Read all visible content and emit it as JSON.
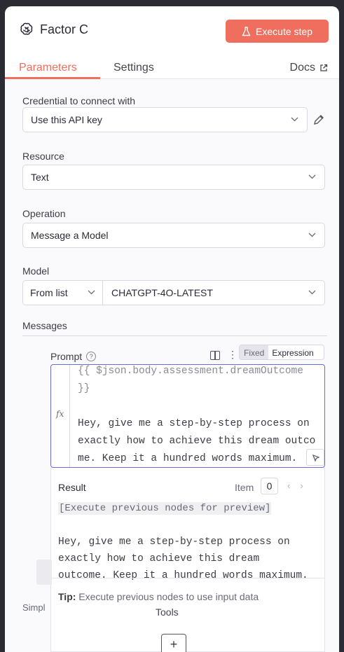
{
  "header": {
    "title": "Factor C",
    "execute_label": "Execute step"
  },
  "tabs": {
    "parameters": "Parameters",
    "settings": "Settings",
    "docs": "Docs"
  },
  "credential": {
    "label": "Credential to connect with",
    "value": "Use this API key"
  },
  "resource": {
    "label": "Resource",
    "value": "Text"
  },
  "operation": {
    "label": "Operation",
    "value": "Message a Model"
  },
  "model": {
    "label": "Model",
    "mode": "From list",
    "value": "CHATGPT-4O-LATEST"
  },
  "messages": {
    "label": "Messages",
    "prompt_label": "Prompt",
    "toggle_fixed": "Fixed",
    "toggle_expression": "Expression",
    "editor_line1": "{{ $json.body.assessment.dreamOutcome",
    "editor_line2": "}}",
    "editor_line3": "",
    "editor_line4": "Hey, give me a step-by-step process on",
    "editor_line5": "exactly how to achieve this dream outco",
    "editor_line6": "me. Keep it a hundred words maximum."
  },
  "result": {
    "title": "Result",
    "item_label": "Item",
    "item_value": "0",
    "preview": "[Execute previous nodes for preview]",
    "line1": "Hey, give me a step-by-step process on",
    "line2": "exactly how to achieve this dream",
    "line3": "outcome. Keep it a hundred words maximum.",
    "tip_bold": "Tip:",
    "tip_text": " Execute previous nodes to use input data"
  },
  "footer": {
    "partial_label": "Simpl",
    "tools_label": "Tools",
    "plus_label": "+"
  },
  "colors": {
    "accent": "#ef6e5d",
    "focus": "#6b6bd6"
  }
}
